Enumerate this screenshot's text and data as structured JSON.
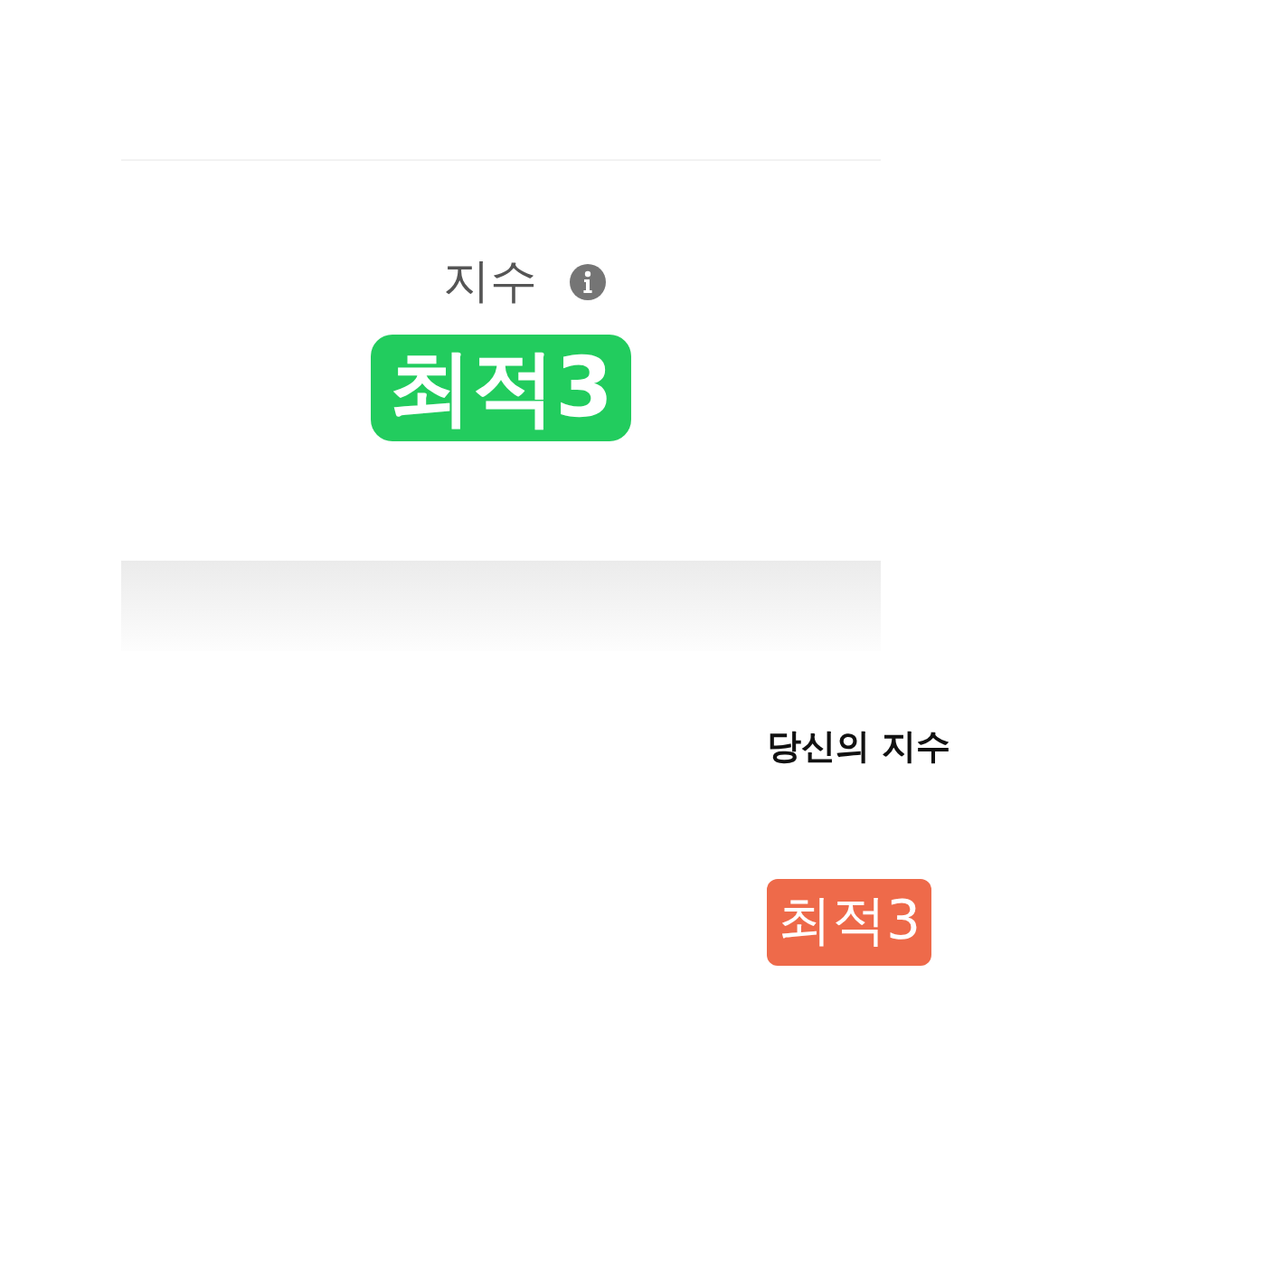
{
  "index_card": {
    "label": "지수",
    "badge": {
      "text": "최적3",
      "color": "#22cc5e"
    }
  },
  "your_index": {
    "label": "당신의 지수",
    "badge": {
      "text": "최적3",
      "color": "#ee6a4a"
    }
  }
}
